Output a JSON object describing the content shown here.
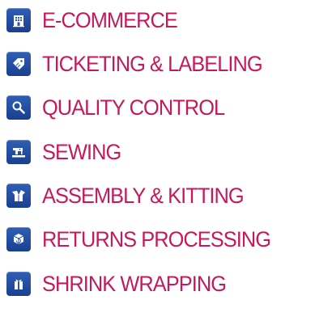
{
  "accent_color": "#c41a5c",
  "icon_background": "#2a56a8",
  "services": [
    {
      "label": "E-COMMERCE",
      "icon": "building-icon"
    },
    {
      "label": "TICKETING & LABELING",
      "icon": "tag-icon"
    },
    {
      "label": "QUALITY CONTROL",
      "icon": "magnifier-icon"
    },
    {
      "label": "SEWING",
      "icon": "sewing-machine-icon"
    },
    {
      "label": "ASSEMBLY & KITTING",
      "icon": "open-box-icon"
    },
    {
      "label": "RETURNS PROCESSING",
      "icon": "return-box-icon"
    },
    {
      "label": "SHRINK WRAPPING",
      "icon": "wrapped-package-icon"
    }
  ]
}
